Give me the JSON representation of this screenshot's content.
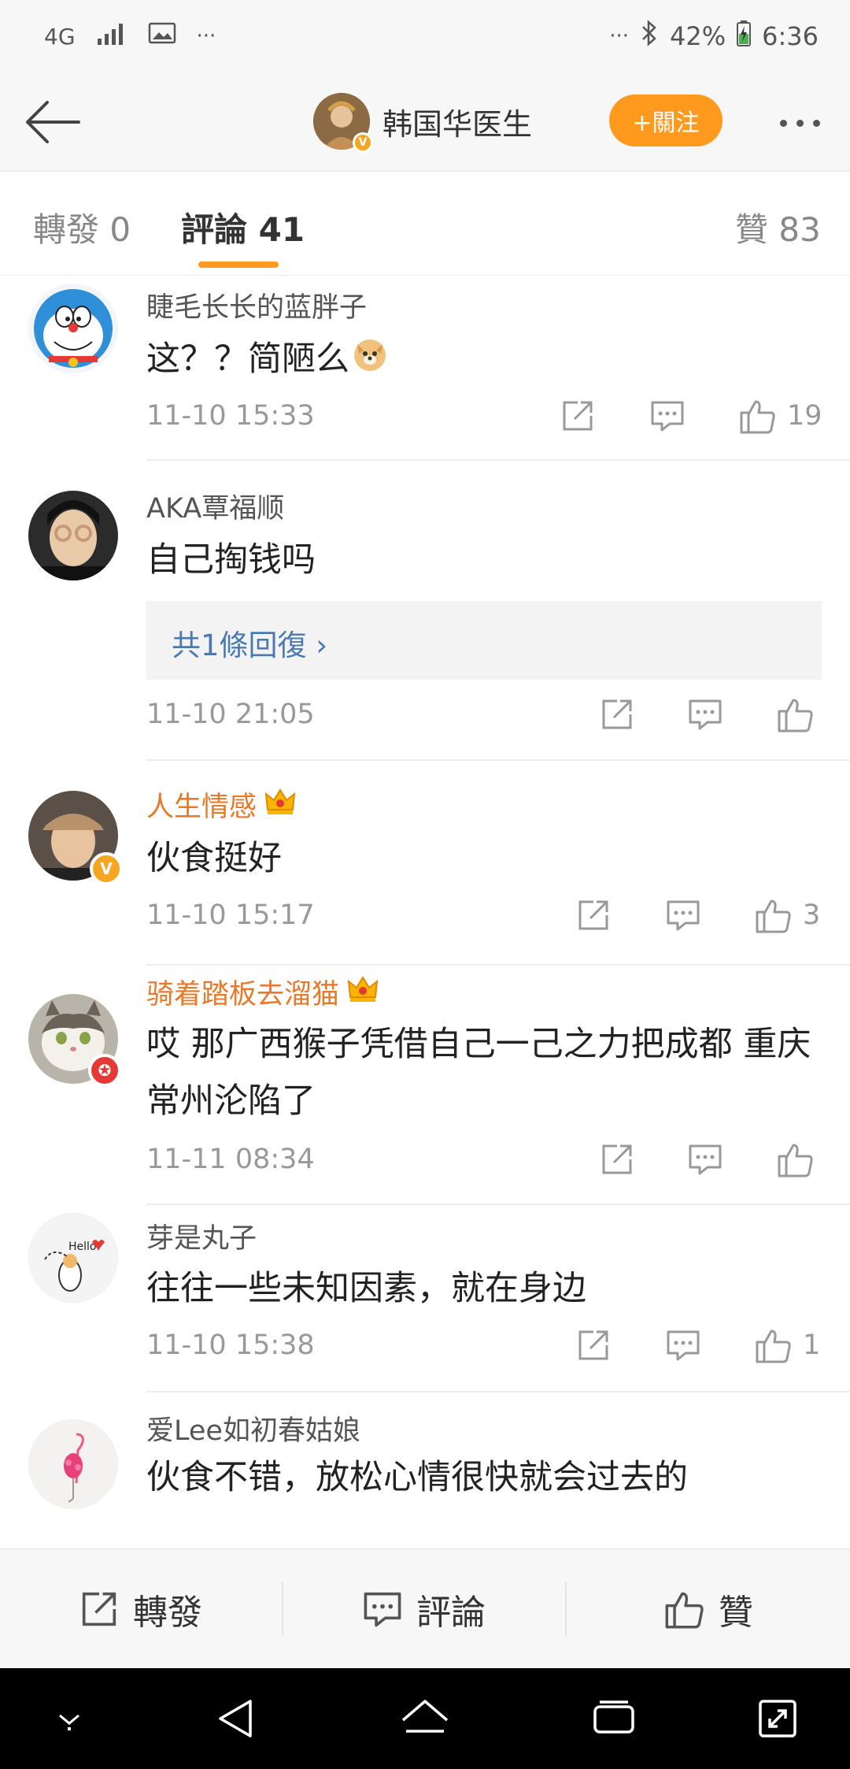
{
  "status_bar": {
    "network": "4G",
    "overflow": "···",
    "overflow_right": "···",
    "battery": "42%",
    "time": "6:36"
  },
  "header": {
    "title": "韩国华医生",
    "follow_label": "+關注",
    "verified_mark": "V"
  },
  "tabs": [
    {
      "label": "轉發 0"
    },
    {
      "label": "評論 41"
    },
    {
      "label": "贊 83"
    }
  ],
  "comments": [
    {
      "name": "睫毛长长的蓝胖子",
      "text": "这？？简陋么",
      "time": "11-10 15:33",
      "likes": "19"
    },
    {
      "name": "AKA覃福顺",
      "text": "自己掏钱吗",
      "reply_label": "共1條回復 ›",
      "time": "11-10 21:05",
      "likes": ""
    },
    {
      "name": "人生情感",
      "text": "伙食挺好",
      "time": "11-10 15:17",
      "likes": "3",
      "badge": "V"
    },
    {
      "name": "骑着踏板去溜猫",
      "text": "哎 那广西猴子凭借自己一己之力把成都 重庆 常州沦陷了",
      "time": "11-11 08:34",
      "likes": ""
    },
    {
      "name": "芽是丸子",
      "text": "往往一些未知因素，就在身边",
      "time": "11-10 15:38",
      "likes": "1",
      "avatar_text": "Hello!"
    },
    {
      "name": "爱Lee如初春姑娘",
      "text": "伙食不错，放松心情很快就会过去的"
    }
  ],
  "bottom_bar": {
    "repost_label": "轉發",
    "comment_label": "評論",
    "like_label": "贊"
  },
  "colors": {
    "accent": "#ff9a1f",
    "vip_name": "#e8782a",
    "link": "#4b7ab1"
  }
}
